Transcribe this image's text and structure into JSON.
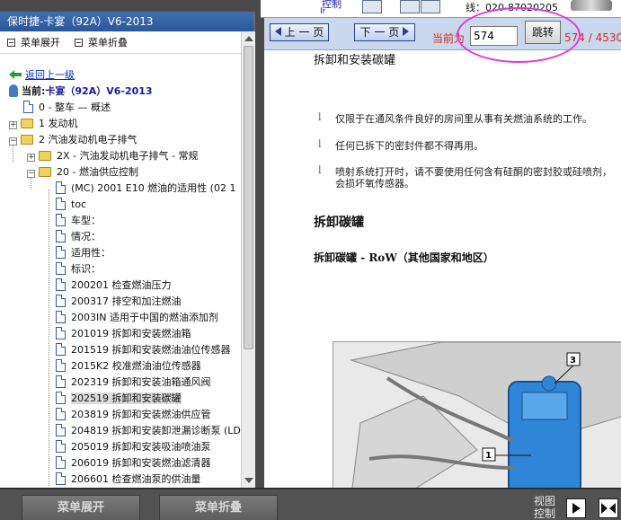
{
  "top": {
    "ctl_text": "控制",
    "sub_text": "Ir",
    "phone_text": "线：020-87020205"
  },
  "sidebar": {
    "title": "保时捷-卡宴（92A）V6-2013",
    "menu_expand": "菜单展开",
    "menu_collapse": "菜单折叠",
    "back_link": "返回上一级",
    "current_label": "当前:",
    "current_value": "卡宴（92A）V6-2013",
    "items": [
      "0 - 整车 — 概述",
      "1 发动机",
      "2 汽油发动机电子排气",
      "2X - 汽油发动机电子排气 - 常规",
      "20 - 燃油供应控制",
      "(MC) 2001 E10 燃油的适用性 (02 1",
      "toc",
      "车型：",
      "情况：",
      "适用性：",
      "标识：",
      "200201 检查燃油压力",
      "200317 排空和加注燃油",
      "2003IN 适用于中国的燃油添加剂",
      "201019 拆卸和安装燃油箱",
      "201519 拆卸和安装燃油油位传感器",
      "2015K2 校准燃油油位传感器",
      "202319 拆卸和安装油箱通风阀",
      "202519 拆卸和安装碳罐",
      "203819 拆卸和安装燃油供应管",
      "204819 拆卸和安装卸泄漏诊断泵 (LD",
      "205019 拆卸和安装吸油喷油泵",
      "206019 拆卸和安装燃油滤清器",
      "206601 检查燃油泵的供油量"
    ]
  },
  "toolbar": {
    "prev_label": "上 一 页",
    "next_label": "下 一 页",
    "current_page_label": "当前为",
    "page_value": "574",
    "jump_label": "跳转",
    "total_label": "574 / 4530"
  },
  "document": {
    "heading": "拆卸和安装碳罐",
    "bullets": [
      "仅限于在通风条件良好的房间里从事有关燃油系统的工作。",
      "任何已拆下的密封件都不得再用。",
      "喷射系统打开时，请不要使用任何含有硅酮的密封胶或硅喷剂，",
      "会损坏氧传感器。"
    ],
    "section_title": "拆卸碳罐",
    "subsection_title": "拆卸碳罐  - RoW（其他国家和地区）",
    "callouts": [
      "3",
      "1"
    ]
  },
  "bottom": {
    "expand_label": "菜单展开",
    "collapse_label": "菜单折叠",
    "view_control_label": "视图控制"
  }
}
